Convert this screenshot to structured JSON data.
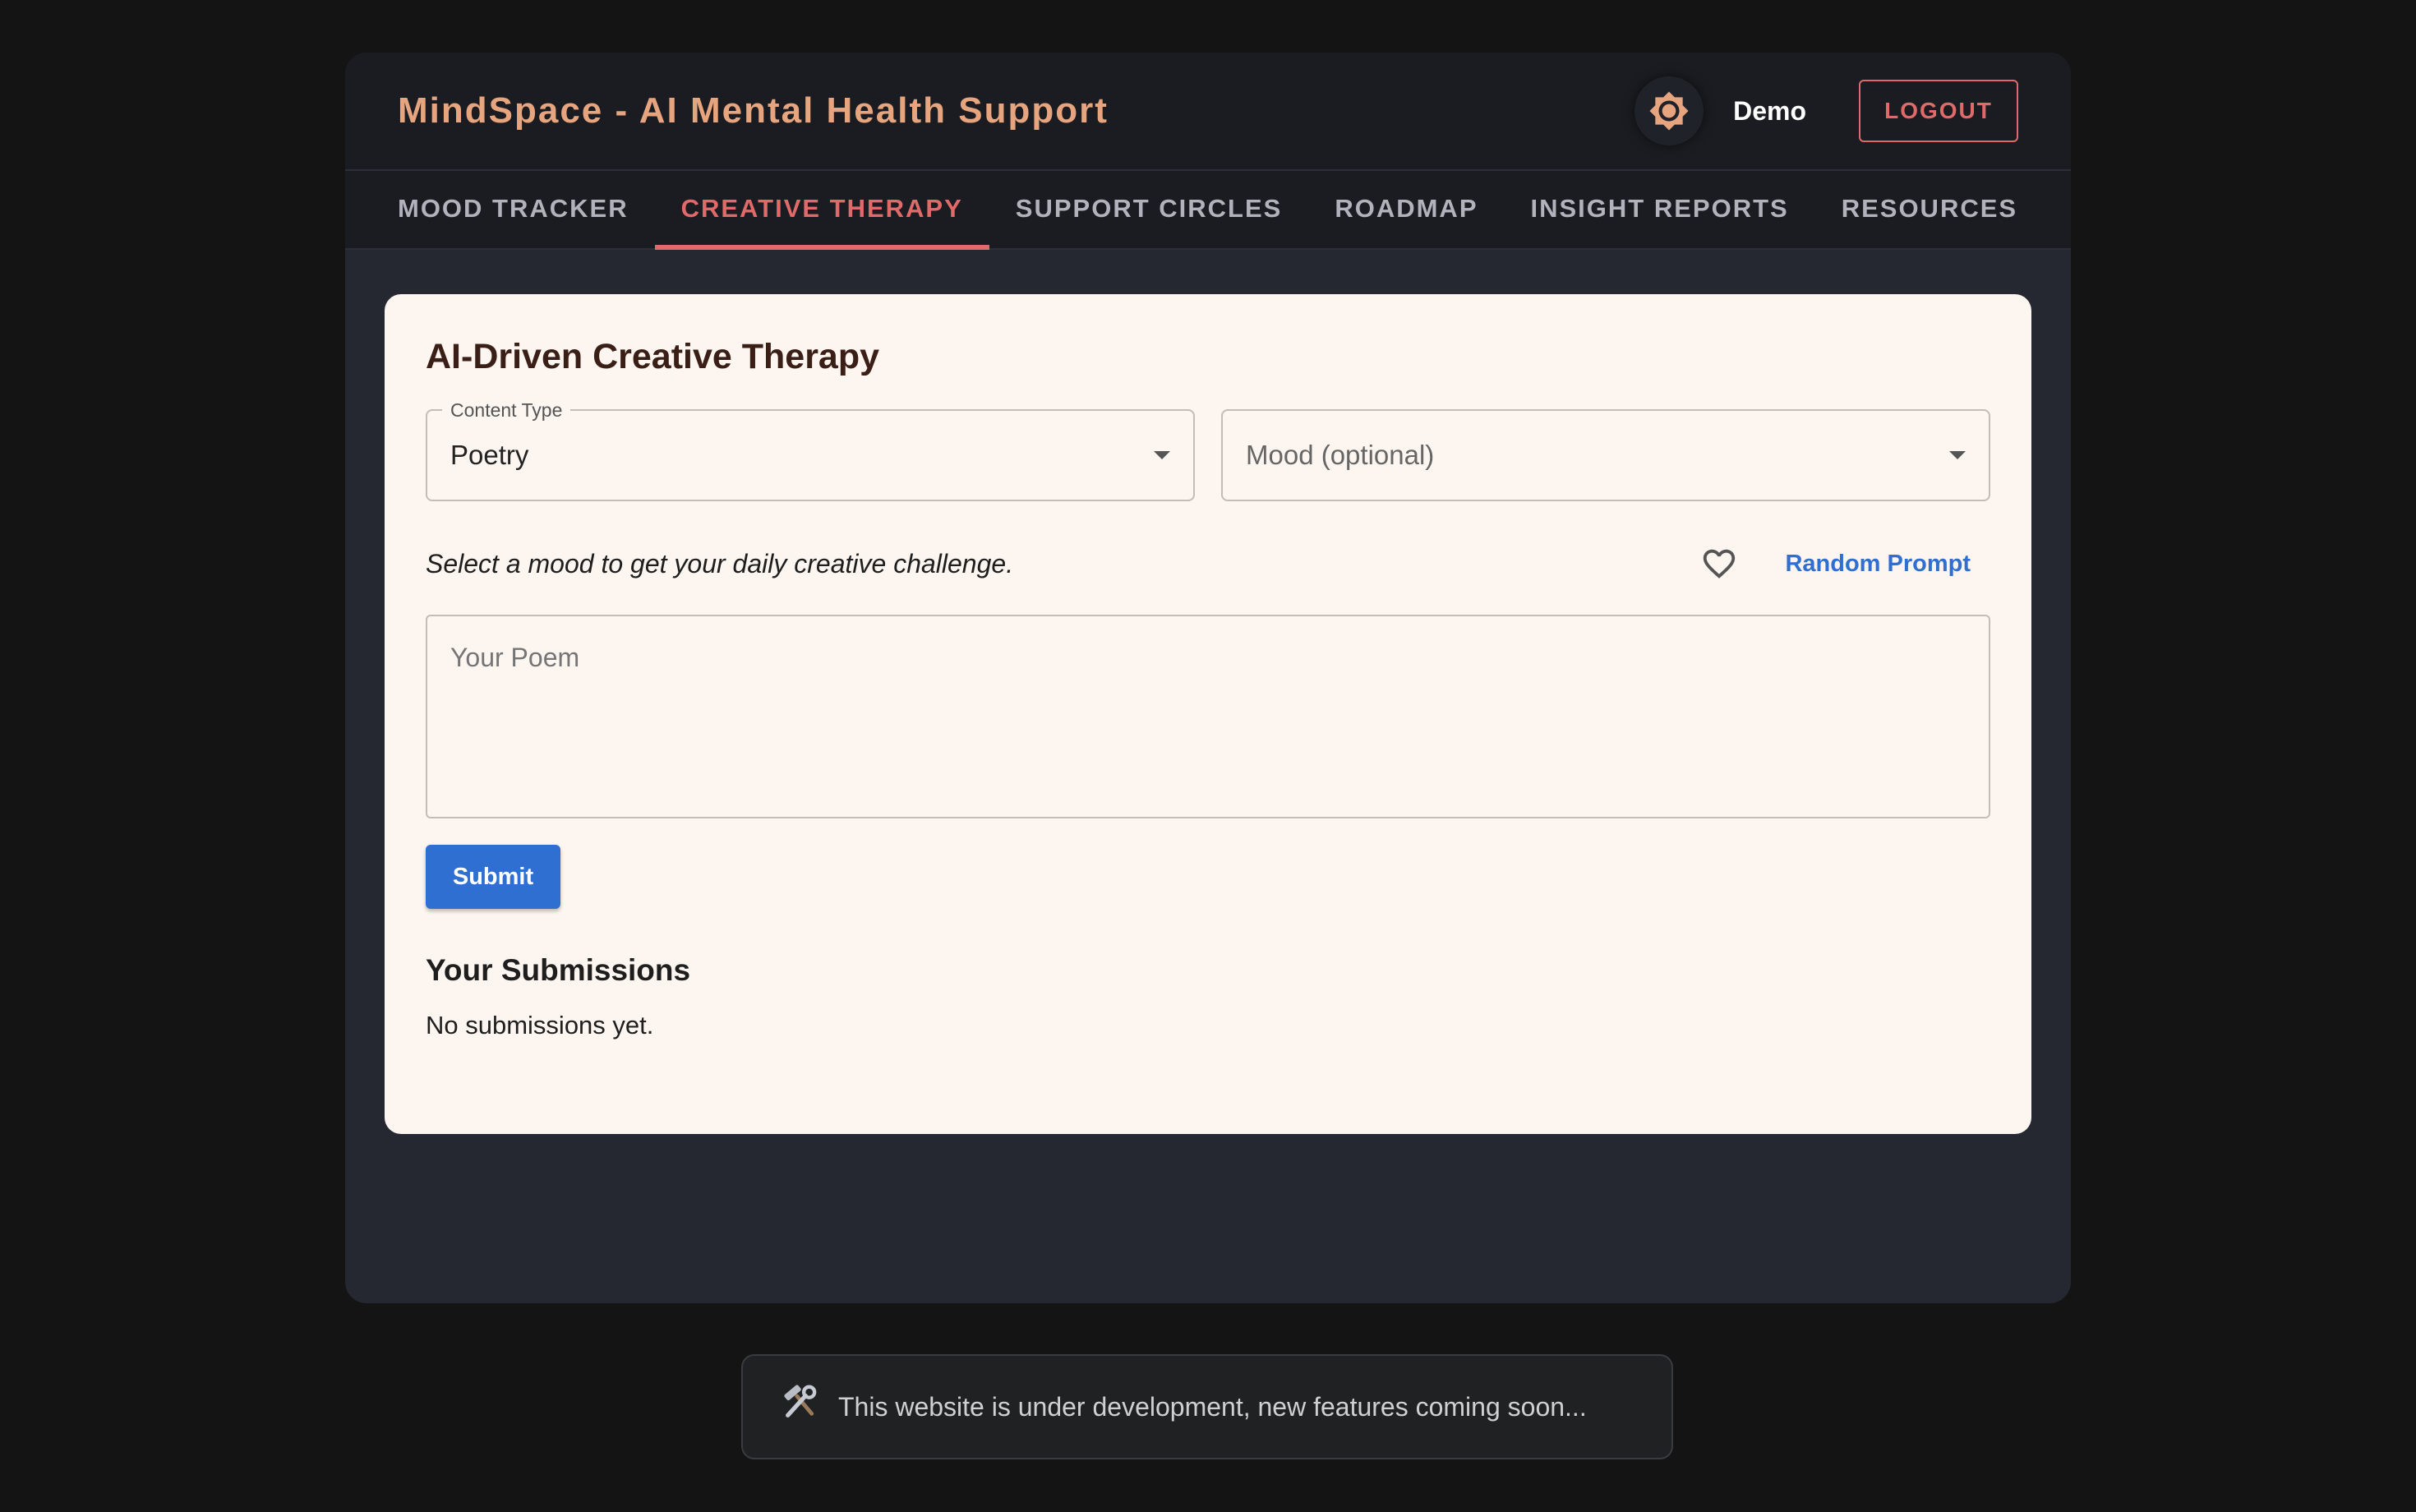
{
  "header": {
    "title": "MindSpace - AI Mental Health Support",
    "user_name": "Demo",
    "logout_label": "LOGOUT",
    "theme_icon": "brightness-icon"
  },
  "tabs": [
    {
      "label": "MOOD TRACKER",
      "active": false
    },
    {
      "label": "CREATIVE THERAPY",
      "active": true
    },
    {
      "label": "SUPPORT CIRCLES",
      "active": false
    },
    {
      "label": "ROADMAP",
      "active": false
    },
    {
      "label": "INSIGHT REPORTS",
      "active": false
    },
    {
      "label": "RESOURCES",
      "active": false
    }
  ],
  "card": {
    "title": "AI-Driven Creative Therapy",
    "content_type": {
      "label": "Content Type",
      "value": "Poetry"
    },
    "mood": {
      "placeholder": "Mood (optional)",
      "value": ""
    },
    "prompt_text": "Select a mood to get your daily creative challenge.",
    "random_prompt_label": "Random Prompt",
    "poem_placeholder": "Your Poem",
    "submit_label": "Submit",
    "submissions_title": "Your Submissions",
    "submissions_empty": "No submissions yet."
  },
  "toast": {
    "text": "This website is under development, new features coming soon..."
  },
  "colors": {
    "accent": "#e06a6a",
    "title": "#e6a57e",
    "primary": "#2f6fd1",
    "card_bg": "#fdf5f0"
  }
}
